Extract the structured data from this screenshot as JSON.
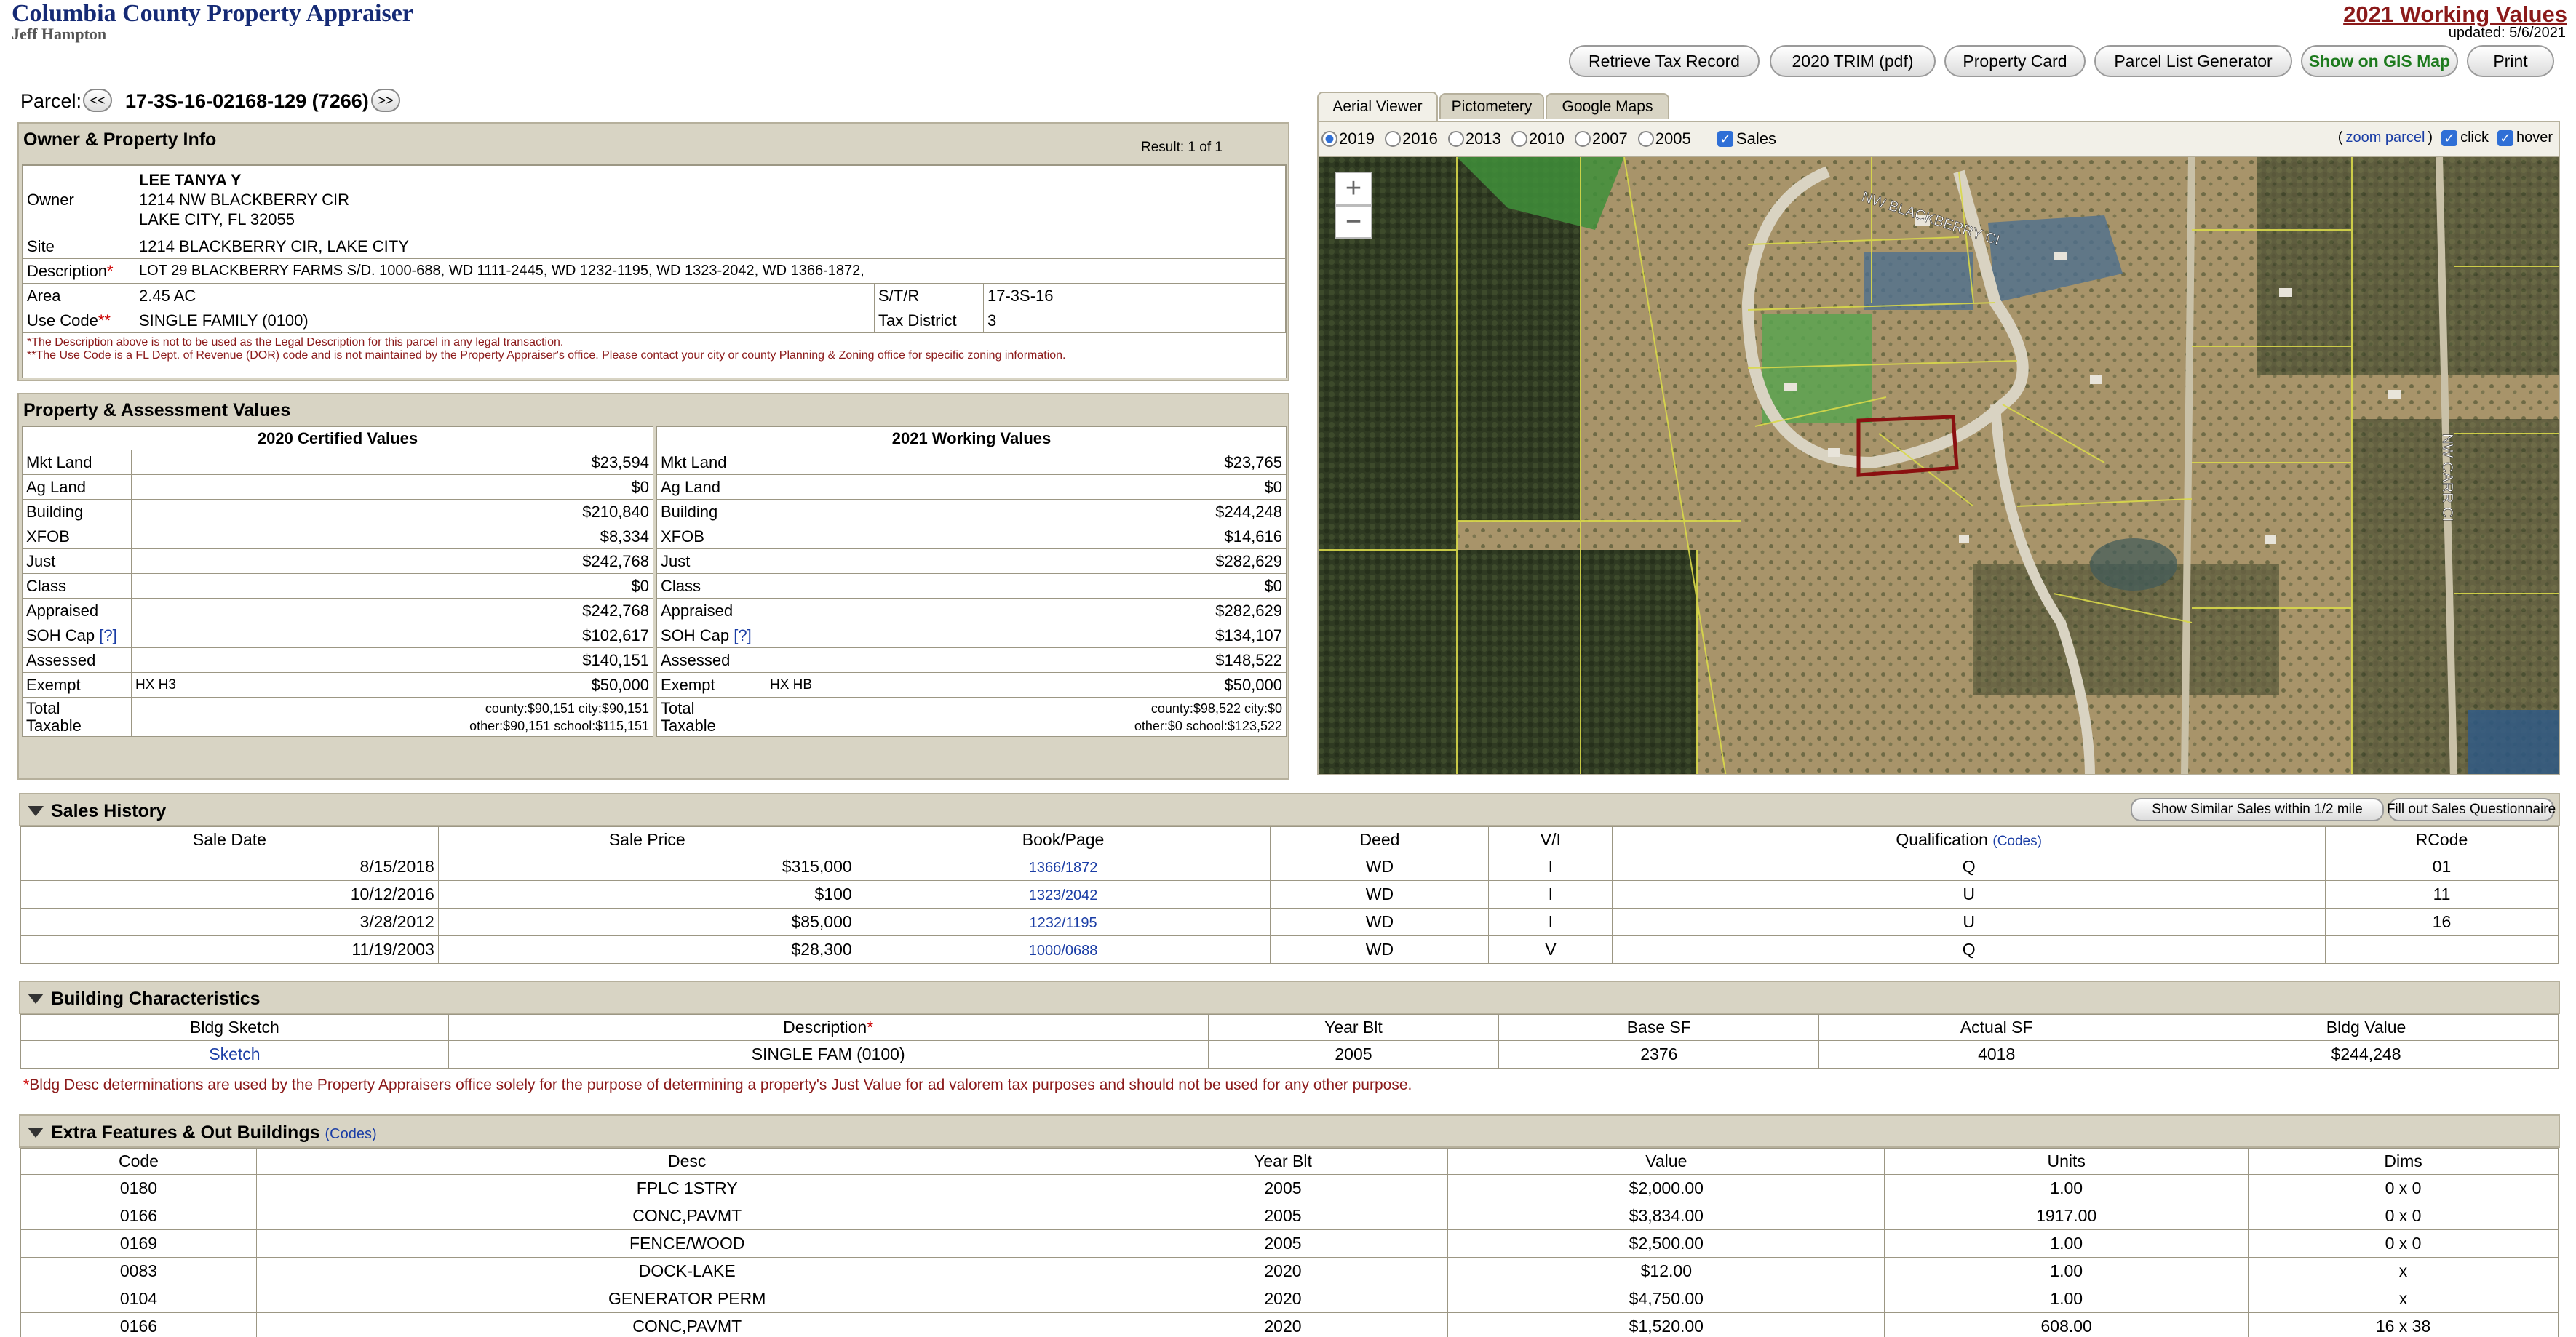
{
  "header": {
    "title": "Columbia County Property Appraiser",
    "subtitle": "Jeff Hampton",
    "working_values_link": "2021 Working Values",
    "updated": "updated: 5/6/2021"
  },
  "toolbar": {
    "retrieve_tax": "Retrieve Tax Record",
    "trim": "2020 TRIM (pdf)",
    "property_card": "Property Card",
    "parcel_list": "Parcel List Generator",
    "gis_map": "Show on GIS Map",
    "print": "Print"
  },
  "parcel": {
    "label": "Parcel:",
    "prev": "<<",
    "number": "17-3S-16-02168-129 (7266)",
    "next": ">>"
  },
  "owner_panel": {
    "title": "Owner & Property Info",
    "result": "Result: 1 of 1",
    "owner_label": "Owner",
    "owner_name": "LEE TANYA Y",
    "owner_addr1": "1214 NW BLACKBERRY CIR",
    "owner_addr2": "LAKE CITY, FL 32055",
    "site_label": "Site",
    "site": "1214 BLACKBERRY CIR, LAKE CITY",
    "desc_label": "Description",
    "description": "LOT 29 BLACKBERRY FARMS S/D. 1000-688, WD 1111-2445, WD 1232-1195, WD 1323-2042, WD 1366-1872,",
    "area_label": "Area",
    "area": "2.45 AC",
    "str_label": "S/T/R",
    "str": "17-3S-16",
    "use_label": "Use Code",
    "use_code": "SINGLE FAMILY (0100)",
    "tax_label": "Tax District",
    "tax_district": "3",
    "note1": "*The Description above is not to be used as the Legal Description for this parcel in any legal transaction.",
    "note2": "**The Use Code is a FL Dept. of Revenue (DOR) code and is not maintained by the Property Appraiser's office. Please contact your city or county Planning & Zoning office for specific zoning information."
  },
  "assessment": {
    "title": "Property & Assessment Values",
    "col2020": "2020 Certified Values",
    "col2021": "2021 Working Values",
    "rows": [
      {
        "label": "Mkt Land",
        "v2020": "$23,594",
        "v2021": "$23,765"
      },
      {
        "label": "Ag Land",
        "v2020": "$0",
        "v2021": "$0"
      },
      {
        "label": "Building",
        "v2020": "$210,840",
        "v2021": "$244,248"
      },
      {
        "label": "XFOB",
        "v2020": "$8,334",
        "v2021": "$14,616"
      },
      {
        "label": "Just",
        "v2020": "$242,768",
        "v2021": "$282,629"
      },
      {
        "label": "Class",
        "v2020": "$0",
        "v2021": "$0"
      },
      {
        "label": "Appraised",
        "v2020": "$242,768",
        "v2021": "$282,629"
      },
      {
        "label": "SOH Cap",
        "v2020": "$102,617",
        "v2021": "$134,107"
      },
      {
        "label": "Assessed",
        "v2020": "$140,151",
        "v2021": "$148,522"
      },
      {
        "label": "Exempt",
        "v2020": "$50,000",
        "v2021": "$50,000"
      }
    ],
    "soh_help": "[?]",
    "exempt_code_2020": "HX H3",
    "exempt_code_2021": "HX HB",
    "total_label1": "Total",
    "total_label2": "Taxable",
    "taxable_2020_line1": "county:$90,151 city:$90,151",
    "taxable_2020_line2": "other:$90,151 school:$115,151",
    "taxable_2021_line1": "county:$98,522 city:$0",
    "taxable_2021_line2": "other:$0 school:$123,522"
  },
  "map": {
    "tabs": [
      "Aerial Viewer",
      "Pictometery",
      "Google Maps"
    ],
    "years": [
      "2019",
      "2016",
      "2013",
      "2010",
      "2007",
      "2005"
    ],
    "selected_year": "2019",
    "sales_label": "Sales",
    "zoom_parcel": "zoom parcel",
    "click_label": "click",
    "hover_label": "hover",
    "zoom_in": "+",
    "zoom_out": "−",
    "road1": "NW BLACKBERRY CI",
    "road2": "NW CARR CI"
  },
  "sales": {
    "title": "Sales History",
    "similar_btn": "Show Similar Sales within 1/2 mile",
    "questionnaire_btn": "Fill out Sales Questionnaire",
    "headers": [
      "Sale Date",
      "Sale Price",
      "Book/Page",
      "Deed",
      "V/I",
      "Qualification",
      "RCode"
    ],
    "codes_link": "(Codes)",
    "rows": [
      [
        "8/15/2018",
        "$315,000",
        "1366/1872",
        "WD",
        "I",
        "Q",
        "01"
      ],
      [
        "10/12/2016",
        "$100",
        "1323/2042",
        "WD",
        "I",
        "U",
        "11"
      ],
      [
        "3/28/2012",
        "$85,000",
        "1232/1195",
        "WD",
        "I",
        "U",
        "16"
      ],
      [
        "11/19/2003",
        "$28,300",
        "1000/0688",
        "WD",
        "V",
        "Q",
        ""
      ]
    ]
  },
  "building": {
    "title": "Building Characteristics",
    "headers": [
      "Bldg Sketch",
      "Description",
      "Year Blt",
      "Base SF",
      "Actual SF",
      "Bldg Value"
    ],
    "row": [
      "Sketch",
      "SINGLE FAM (0100)",
      "2005",
      "2376",
      "4018",
      "$244,248"
    ],
    "note": "Bldg Desc determinations are used by the Property Appraisers office solely for the purpose of determining a property's Just Value for ad valorem tax purposes and should not be used for any other purpose."
  },
  "extra": {
    "title": "Extra Features & Out Buildings",
    "codes_link": "(Codes)",
    "headers": [
      "Code",
      "Desc",
      "Year Blt",
      "Value",
      "Units",
      "Dims"
    ],
    "rows": [
      [
        "0180",
        "FPLC 1STRY",
        "2005",
        "$2,000.00",
        "1.00",
        "0 x 0"
      ],
      [
        "0166",
        "CONC,PAVMT",
        "2005",
        "$3,834.00",
        "1917.00",
        "0 x 0"
      ],
      [
        "0169",
        "FENCE/WOOD",
        "2005",
        "$2,500.00",
        "1.00",
        "0 x 0"
      ],
      [
        "0083",
        "DOCK-LAKE",
        "2020",
        "$12.00",
        "1.00",
        "x"
      ],
      [
        "0104",
        "GENERATOR PERM",
        "2020",
        "$4,750.00",
        "1.00",
        "x"
      ],
      [
        "0166",
        "CONC,PAVMT",
        "2020",
        "$1,520.00",
        "608.00",
        "16 x 38"
      ]
    ]
  },
  "colors": {
    "title_blue": "#152a75",
    "working_red": "#8b1a1a",
    "gis_green": "#1d7a1d",
    "panel_tan": "#d8d4c4",
    "link_blue": "#1a3da5"
  }
}
